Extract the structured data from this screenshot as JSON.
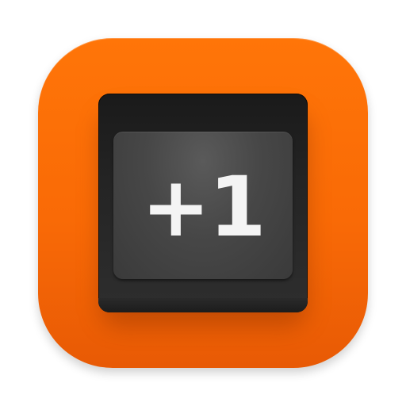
{
  "icon": {
    "name": "plus-one-app-icon",
    "background_color": "#f96a06",
    "keycap_color": "#474747",
    "label": "+1",
    "label_color": "#f4f4f4"
  }
}
